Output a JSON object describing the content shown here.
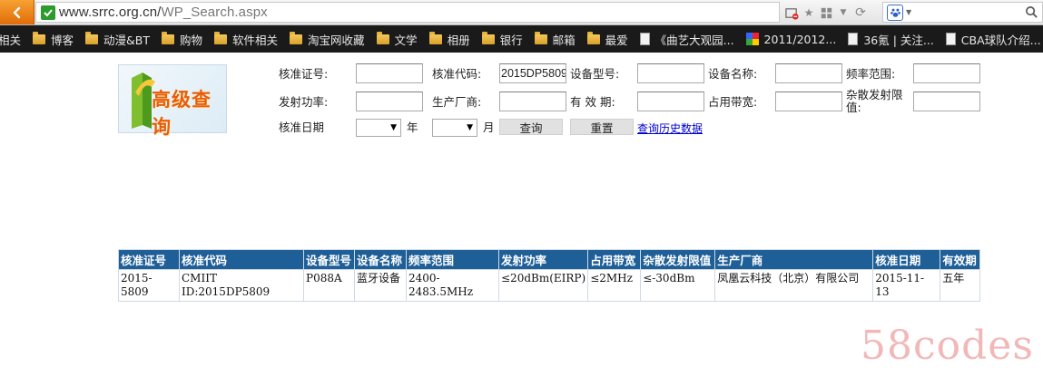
{
  "browser": {
    "url_host": "www.srrc.org.cn/",
    "url_path": "WP_Search.aspx"
  },
  "bookmarks": [
    {
      "label": "相关",
      "icon": "none"
    },
    {
      "label": "博客",
      "icon": "folder"
    },
    {
      "label": "动漫&BT",
      "icon": "folder"
    },
    {
      "label": "购物",
      "icon": "folder"
    },
    {
      "label": "软件相关",
      "icon": "folder"
    },
    {
      "label": "淘宝网收藏",
      "icon": "folder"
    },
    {
      "label": "文学",
      "icon": "folder"
    },
    {
      "label": "相册",
      "icon": "folder"
    },
    {
      "label": "银行",
      "icon": "folder"
    },
    {
      "label": "邮箱",
      "icon": "folder"
    },
    {
      "label": "最爱",
      "icon": "folder"
    },
    {
      "label": "《曲艺大观园...",
      "icon": "page"
    },
    {
      "label": "2011/2012...",
      "icon": "mosaic"
    },
    {
      "label": "36氪 | 关注...",
      "icon": "page"
    },
    {
      "label": "CBA球队介绍...",
      "icon": "page"
    }
  ],
  "logo": {
    "text": "高级查询"
  },
  "form": {
    "cert_no": {
      "label": "核准证号:",
      "value": ""
    },
    "cert_code": {
      "label": "核准代码:",
      "value": "2015DP5809"
    },
    "model": {
      "label": "设备型号:",
      "value": ""
    },
    "device_name": {
      "label": "设备名称:",
      "value": ""
    },
    "freq_range": {
      "label": "频率范围:",
      "value": ""
    },
    "tx_power": {
      "label": "发射功率:",
      "value": ""
    },
    "maker": {
      "label": "生产厂商:",
      "value": ""
    },
    "valid_period": {
      "label": "有 效 期:",
      "value": ""
    },
    "bandwidth": {
      "label": "占用带宽:",
      "value": ""
    },
    "spurious": {
      "label": "杂散发射限值:",
      "value": ""
    },
    "date_label": "核准日期",
    "year_label": "年",
    "month_label": "月",
    "year_value": "",
    "month_value": "",
    "query_button": "查询",
    "reset_button": "重置",
    "history_link": "查询历史数据"
  },
  "results": {
    "headers": [
      "核准证号",
      "核准代码",
      "设备型号",
      "设备名称",
      "频率范围",
      "发射功率",
      "占用带宽",
      "杂散发射限值",
      "生产厂商",
      "核准日期",
      "有效期"
    ],
    "rows": [
      [
        "2015-5809",
        "CMIIT ID:2015DP5809",
        "P088A",
        "蓝牙设备",
        "2400-2483.5MHz",
        "≤20dBm(EIRP)",
        "≤2MHz",
        "≤-30dBm",
        "凤凰云科技（北京）有限公司",
        "2015-11-13",
        "五年"
      ]
    ]
  },
  "watermark": "58codes"
}
